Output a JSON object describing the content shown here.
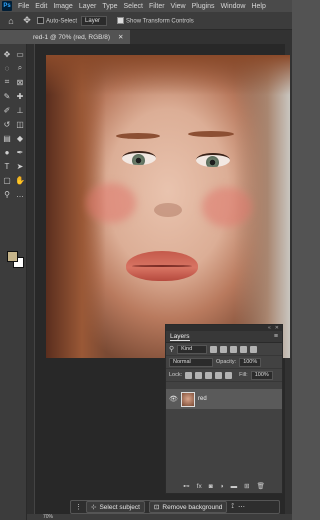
{
  "menu": {
    "logo": "Ps",
    "items": [
      "File",
      "Edit",
      "Image",
      "Layer",
      "Type",
      "Select",
      "Filter",
      "View",
      "Plugins",
      "Window",
      "Help"
    ]
  },
  "options": {
    "auto_select": "Auto-Select",
    "target": "Layer",
    "transform_controls": "Show Transform Controls"
  },
  "document": {
    "tab_title": "red-1 @ 70% (red, RGB/8)",
    "zoom": "70%"
  },
  "layers_panel": {
    "title": "Layers",
    "filter_kind": "Kind",
    "blend_mode": "Normal",
    "opacity_label": "Opacity:",
    "opacity_value": "100%",
    "lock_label": "Lock:",
    "fill_label": "Fill:",
    "fill_value": "100%",
    "layer_name": "red"
  },
  "context_bar": {
    "select_subject": "Select subject",
    "remove_background": "Remove background"
  },
  "colors": {
    "foreground": "#c5b48a",
    "background": "#ffffff",
    "ui_dark": "#3c3c3c"
  }
}
